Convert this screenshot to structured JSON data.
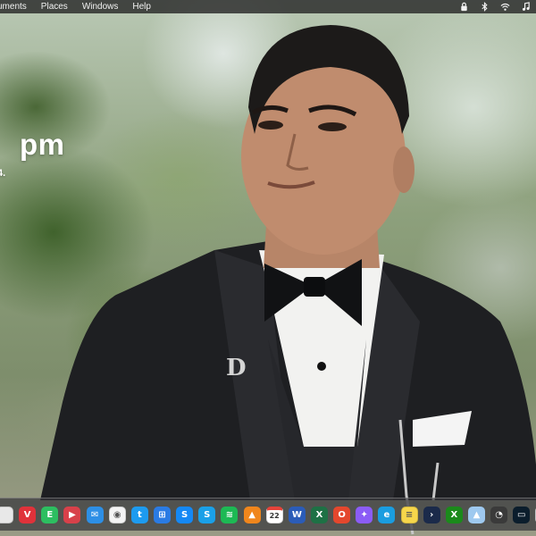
{
  "menubar": {
    "items": [
      {
        "label": "uments"
      },
      {
        "label": "Places"
      },
      {
        "label": "Windows"
      },
      {
        "label": "Help"
      }
    ],
    "status_icons": [
      "lock-icon",
      "bluetooth-icon",
      "wifi-icon",
      "music-note-icon"
    ]
  },
  "desktop": {
    "clock_time": "pm",
    "clock_date": "4."
  },
  "dock": {
    "items": [
      {
        "name": "app-partial-icon",
        "color": "#e8e8e8",
        "glyph": ""
      },
      {
        "name": "vivaldi-icon",
        "color": "#e0323a",
        "glyph": "V"
      },
      {
        "name": "evernote-icon",
        "color": "#2dbe60",
        "glyph": "E"
      },
      {
        "name": "clapperboard-icon",
        "color": "#d8414a",
        "glyph": "▶"
      },
      {
        "name": "mail-icon",
        "color": "#2d8fe6",
        "glyph": "✉"
      },
      {
        "name": "chrome-icon",
        "color": "#f4f4f4",
        "glyph": "◉"
      },
      {
        "name": "twitter-icon",
        "color": "#1d9bf0",
        "glyph": "t"
      },
      {
        "name": "windows-grid-icon",
        "color": "#2a7be4",
        "glyph": "⊞"
      },
      {
        "name": "shazam-icon",
        "color": "#1488f5",
        "glyph": "S"
      },
      {
        "name": "skype-icon",
        "color": "#1aa0e8",
        "glyph": "S"
      },
      {
        "name": "spotify-icon",
        "color": "#1db954",
        "glyph": "≋"
      },
      {
        "name": "vlc-cone-icon",
        "color": "#f0861c",
        "glyph": "▲"
      },
      {
        "name": "calendar-icon",
        "color": "#ffffff",
        "glyph": "22"
      },
      {
        "name": "word-icon",
        "color": "#2b5cb8",
        "glyph": "W"
      },
      {
        "name": "excel-icon",
        "color": "#1e7145",
        "glyph": "X"
      },
      {
        "name": "office-icon",
        "color": "#e4472d",
        "glyph": "O"
      },
      {
        "name": "messenger-icon",
        "color": "#8b5cf6",
        "glyph": "✦"
      },
      {
        "name": "edge-icon",
        "color": "#1a9de0",
        "glyph": "e"
      },
      {
        "name": "notes-icon",
        "color": "#f6d64b",
        "glyph": "≡"
      },
      {
        "name": "terminal-icon",
        "color": "#1b2a4a",
        "glyph": "›"
      },
      {
        "name": "xbox-icon",
        "color": "#1b8a1b",
        "glyph": "X"
      },
      {
        "name": "image-preview-icon",
        "color": "#9ec9ef",
        "glyph": "▲"
      },
      {
        "name": "system-monitor-icon",
        "color": "#3a3a3a",
        "glyph": "◔"
      },
      {
        "name": "console-icon",
        "color": "#0b1d2c",
        "glyph": "▭"
      },
      {
        "name": "app-partial-right-icon",
        "color": "#e8e8e8",
        "glyph": ""
      }
    ]
  }
}
